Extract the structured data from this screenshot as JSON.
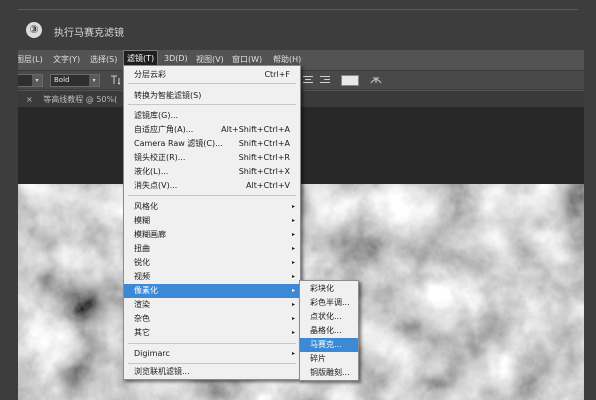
{
  "step": {
    "number": "③",
    "title": "执行马赛克滤镜"
  },
  "menubar": {
    "items": [
      {
        "label": "图层(L)"
      },
      {
        "label": "文字(Y)"
      },
      {
        "label": "选择(S)"
      },
      {
        "label": "滤镜(T)",
        "active": true
      },
      {
        "label": "3D(D)"
      },
      {
        "label": "视图(V)"
      },
      {
        "label": "窗口(W)"
      },
      {
        "label": "帮助(H)"
      }
    ]
  },
  "options_bar": {
    "font_style": "Bold",
    "text_orientation_icon": "text-orientation-icon",
    "align_icons": [
      "align-center-icon",
      "align-right-icon"
    ],
    "color_swatch": "#e8e8e8"
  },
  "document_tab": {
    "close": "×",
    "title": "等高线教程 @ 50%("
  },
  "filter_menu": {
    "items": [
      {
        "label": "分层云彩",
        "shortcut": "Ctrl+F"
      },
      {
        "separator": true
      },
      {
        "label": "转换为智能滤镜(S)"
      },
      {
        "separator": true
      },
      {
        "label": "滤镜库(G)..."
      },
      {
        "label": "自适应广角(A)...",
        "shortcut": "Alt+Shift+Ctrl+A"
      },
      {
        "label": "Camera Raw 滤镜(C)...",
        "shortcut": "Shift+Ctrl+A"
      },
      {
        "label": "镜头校正(R)...",
        "shortcut": "Shift+Ctrl+R"
      },
      {
        "label": "液化(L)...",
        "shortcut": "Shift+Ctrl+X"
      },
      {
        "label": "消失点(V)...",
        "shortcut": "Alt+Ctrl+V"
      },
      {
        "separator": true
      },
      {
        "label": "风格化",
        "submenu": true
      },
      {
        "label": "模糊",
        "submenu": true
      },
      {
        "label": "模糊画廊",
        "submenu": true
      },
      {
        "label": "扭曲",
        "submenu": true
      },
      {
        "label": "锐化",
        "submenu": true
      },
      {
        "label": "视频",
        "submenu": true
      },
      {
        "label": "像素化",
        "submenu": true,
        "highlighted": true
      },
      {
        "label": "渲染",
        "submenu": true
      },
      {
        "label": "杂色",
        "submenu": true
      },
      {
        "label": "其它",
        "submenu": true
      },
      {
        "separator": true
      },
      {
        "label": "Digimarc",
        "submenu": true
      },
      {
        "separator": true
      },
      {
        "label": "浏览联机滤镜..."
      }
    ]
  },
  "pixelate_submenu": {
    "items": [
      {
        "label": "彩块化"
      },
      {
        "label": "彩色半调..."
      },
      {
        "label": "点状化..."
      },
      {
        "label": "晶格化..."
      },
      {
        "label": "马赛克...",
        "highlighted": true
      },
      {
        "label": "碎片"
      },
      {
        "label": "铜版雕刻..."
      }
    ]
  },
  "submenu_arrow": "▸",
  "dropdown_arrow": "▾",
  "colors": {
    "highlight": "#3c8ad6",
    "menu_bg": "#f0f0f0",
    "app_bg": "#535353",
    "workspace": "#282828"
  }
}
